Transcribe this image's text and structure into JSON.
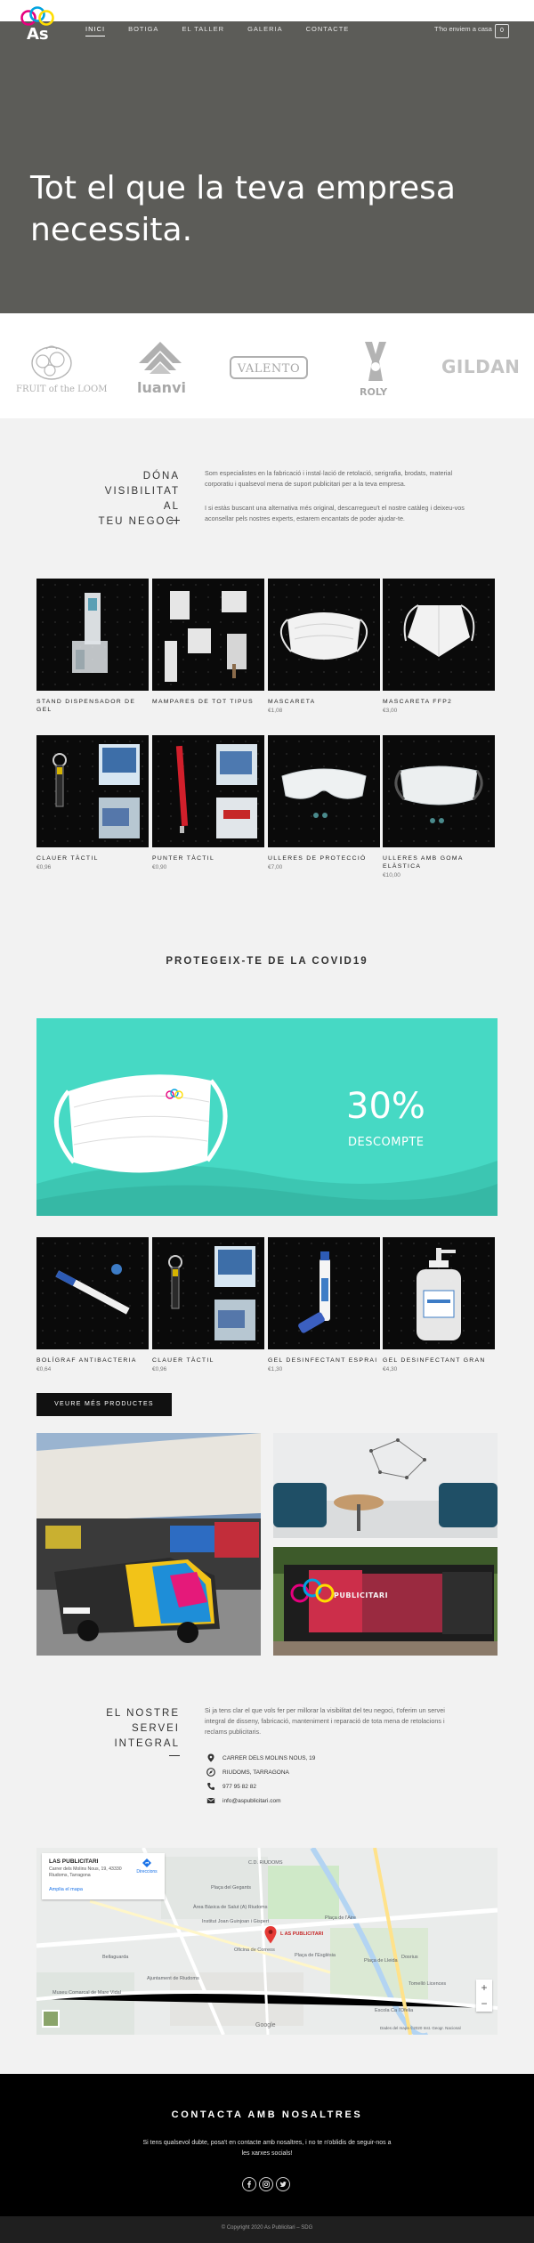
{
  "header": {
    "logo_text": "As",
    "nav": [
      "INICI",
      "BOTIGA",
      "EL TALLER",
      "GALERIA",
      "CONTACTE"
    ],
    "ship_note": "T'ho enviem a casa",
    "cart_count": "0"
  },
  "hero": {
    "title": "Tot el que la teva empresa necessita."
  },
  "brands": {
    "fruit": "FRUIT of the LOOM",
    "luanvi": "luanvi",
    "valento": "VALENTO",
    "roly": "ROLY",
    "gildan": "GILDAN"
  },
  "intro": {
    "heading": [
      "DÓNA",
      "VISIBILITAT AL",
      "TEU NEGOCI"
    ],
    "p1": "Som especialistes en la fabricació i instal·lació de retolació, serigrafia, brodats, material corporatiu i qualsevol mena de suport publicitari per a la teva empresa.",
    "p2": "I si estàs buscant una alternativa més original, descarregueu't el nostre catàleg i deixeu-vos aconsellar pels nostres experts, estarem encantats de poder ajudar-te."
  },
  "products": [
    {
      "name": "STAND DISPENSADOR DE GEL",
      "price": ""
    },
    {
      "name": "MAMPARES DE TOT TIPUS",
      "price": ""
    },
    {
      "name": "MASCARETA",
      "price": "€1,08"
    },
    {
      "name": "MASCARETA FFP2",
      "price": "€3,00"
    },
    {
      "name": "CLAUER TÀCTIL",
      "price": "€0,96"
    },
    {
      "name": "PUNTER TÀCTIL",
      "price": "€0,90"
    },
    {
      "name": "ULLERES DE PROTECCIÓ",
      "price": "€7,00"
    },
    {
      "name": "ULLERES AMB GOMA ELÀSTICA",
      "price": "€10,00"
    }
  ],
  "covid": {
    "title": "PROTEGEIX-TE DE LA COVID19",
    "banner_pct": "30%",
    "banner_sub": "DESCOMPTE",
    "products": [
      {
        "name": "BOLÍGRAF ANTIBACTERIA",
        "price": "€0,64"
      },
      {
        "name": "CLAUER TÀCTIL",
        "price": "€0,96"
      },
      {
        "name": "GEL DESINFECTANT ESPRAI",
        "price": "€1,30"
      },
      {
        "name": "GEL DESINFECTANT GRAN",
        "price": "€4,30"
      }
    ],
    "button": "VEURE MÉS PRODUCTES"
  },
  "service": {
    "heading": [
      "EL NOSTRE",
      "SERVEI",
      "INTEGRAL"
    ],
    "text": "Si ja tens clar el que vols fer per millorar la visibilitat del teu negoci, t'oferim un servei integral de disseny, fabricació, manteniment i reparació de tota mena de retolacions i reclams publicitaris.",
    "address": "CARRER DELS MOLINS NOUS, 19",
    "city": "RIUDOMS, TARRAGONA",
    "phone": "977 95 82 82",
    "email": "info@aspublicitari.com",
    "photo_sign": "PUBLICITARI"
  },
  "map": {
    "card_title": "LAS PUBLICITARI",
    "card_address": "Carrer dels Molins Nous, 19, 43330 Riudoms, Tarragona",
    "card_link": "Amplia el mapa",
    "card_dir": "Direccions",
    "pin_label": "L AS PUBLICITARI",
    "labels": [
      "C.D. RIUDOMS",
      "Plaça del Gegants",
      "Àrea Bàsica de Salut (A) Riudoms",
      "Institut Joan Guinjoan i Gispert",
      "Oficina de Correos",
      "Plaça de l'Església",
      "Ajuntament de Riudoms",
      "Museu Comarcal de Mare Vidal",
      "Bellaguarda",
      "Plaça de l'Aire",
      "Dosrius",
      "Plaça de Lleida",
      "Tomelló Licences",
      "Escola Ca l'Ofelia",
      "Google",
      "Dades del mapa ©2020 Inst. Geogr. Nacional"
    ],
    "zoom_in": "+",
    "zoom_out": "−"
  },
  "footer": {
    "title": "CONTACTA AMB NOSALTRES",
    "text": "Si tens qualsevol dubte, posa't en contacte amb nosaltres, i no te n'oblidis de seguir-nos a les xarxes socials!",
    "copyright": "© Copyright 2020 As Publicitari – SDG"
  },
  "colors": {
    "hero_bg": "#5c5c58",
    "banner_bg": "#46d9c4",
    "footer_bg": "#000000",
    "accent_pin": "#e53935"
  }
}
